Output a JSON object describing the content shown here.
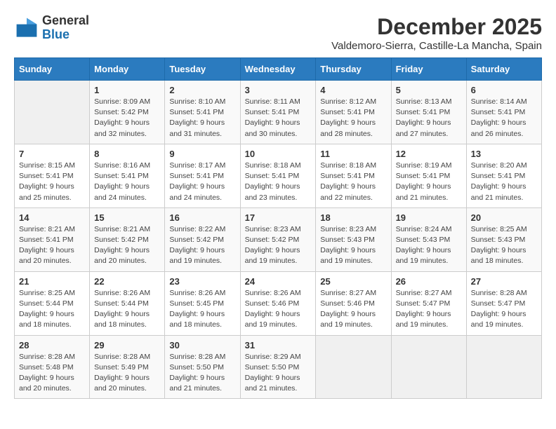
{
  "header": {
    "logo_line1": "General",
    "logo_line2": "Blue",
    "title": "December 2025",
    "subtitle": "Valdemoro-Sierra, Castille-La Mancha, Spain"
  },
  "calendar": {
    "days_of_week": [
      "Sunday",
      "Monday",
      "Tuesday",
      "Wednesday",
      "Thursday",
      "Friday",
      "Saturday"
    ],
    "weeks": [
      [
        {
          "day": "",
          "info": ""
        },
        {
          "day": "1",
          "info": "Sunrise: 8:09 AM\nSunset: 5:42 PM\nDaylight: 9 hours\nand 32 minutes."
        },
        {
          "day": "2",
          "info": "Sunrise: 8:10 AM\nSunset: 5:41 PM\nDaylight: 9 hours\nand 31 minutes."
        },
        {
          "day": "3",
          "info": "Sunrise: 8:11 AM\nSunset: 5:41 PM\nDaylight: 9 hours\nand 30 minutes."
        },
        {
          "day": "4",
          "info": "Sunrise: 8:12 AM\nSunset: 5:41 PM\nDaylight: 9 hours\nand 28 minutes."
        },
        {
          "day": "5",
          "info": "Sunrise: 8:13 AM\nSunset: 5:41 PM\nDaylight: 9 hours\nand 27 minutes."
        },
        {
          "day": "6",
          "info": "Sunrise: 8:14 AM\nSunset: 5:41 PM\nDaylight: 9 hours\nand 26 minutes."
        }
      ],
      [
        {
          "day": "7",
          "info": "Sunrise: 8:15 AM\nSunset: 5:41 PM\nDaylight: 9 hours\nand 25 minutes."
        },
        {
          "day": "8",
          "info": "Sunrise: 8:16 AM\nSunset: 5:41 PM\nDaylight: 9 hours\nand 24 minutes."
        },
        {
          "day": "9",
          "info": "Sunrise: 8:17 AM\nSunset: 5:41 PM\nDaylight: 9 hours\nand 24 minutes."
        },
        {
          "day": "10",
          "info": "Sunrise: 8:18 AM\nSunset: 5:41 PM\nDaylight: 9 hours\nand 23 minutes."
        },
        {
          "day": "11",
          "info": "Sunrise: 8:18 AM\nSunset: 5:41 PM\nDaylight: 9 hours\nand 22 minutes."
        },
        {
          "day": "12",
          "info": "Sunrise: 8:19 AM\nSunset: 5:41 PM\nDaylight: 9 hours\nand 21 minutes."
        },
        {
          "day": "13",
          "info": "Sunrise: 8:20 AM\nSunset: 5:41 PM\nDaylight: 9 hours\nand 21 minutes."
        }
      ],
      [
        {
          "day": "14",
          "info": "Sunrise: 8:21 AM\nSunset: 5:41 PM\nDaylight: 9 hours\nand 20 minutes."
        },
        {
          "day": "15",
          "info": "Sunrise: 8:21 AM\nSunset: 5:42 PM\nDaylight: 9 hours\nand 20 minutes."
        },
        {
          "day": "16",
          "info": "Sunrise: 8:22 AM\nSunset: 5:42 PM\nDaylight: 9 hours\nand 19 minutes."
        },
        {
          "day": "17",
          "info": "Sunrise: 8:23 AM\nSunset: 5:42 PM\nDaylight: 9 hours\nand 19 minutes."
        },
        {
          "day": "18",
          "info": "Sunrise: 8:23 AM\nSunset: 5:43 PM\nDaylight: 9 hours\nand 19 minutes."
        },
        {
          "day": "19",
          "info": "Sunrise: 8:24 AM\nSunset: 5:43 PM\nDaylight: 9 hours\nand 19 minutes."
        },
        {
          "day": "20",
          "info": "Sunrise: 8:25 AM\nSunset: 5:43 PM\nDaylight: 9 hours\nand 18 minutes."
        }
      ],
      [
        {
          "day": "21",
          "info": "Sunrise: 8:25 AM\nSunset: 5:44 PM\nDaylight: 9 hours\nand 18 minutes."
        },
        {
          "day": "22",
          "info": "Sunrise: 8:26 AM\nSunset: 5:44 PM\nDaylight: 9 hours\nand 18 minutes."
        },
        {
          "day": "23",
          "info": "Sunrise: 8:26 AM\nSunset: 5:45 PM\nDaylight: 9 hours\nand 18 minutes."
        },
        {
          "day": "24",
          "info": "Sunrise: 8:26 AM\nSunset: 5:46 PM\nDaylight: 9 hours\nand 19 minutes."
        },
        {
          "day": "25",
          "info": "Sunrise: 8:27 AM\nSunset: 5:46 PM\nDaylight: 9 hours\nand 19 minutes."
        },
        {
          "day": "26",
          "info": "Sunrise: 8:27 AM\nSunset: 5:47 PM\nDaylight: 9 hours\nand 19 minutes."
        },
        {
          "day": "27",
          "info": "Sunrise: 8:28 AM\nSunset: 5:47 PM\nDaylight: 9 hours\nand 19 minutes."
        }
      ],
      [
        {
          "day": "28",
          "info": "Sunrise: 8:28 AM\nSunset: 5:48 PM\nDaylight: 9 hours\nand 20 minutes."
        },
        {
          "day": "29",
          "info": "Sunrise: 8:28 AM\nSunset: 5:49 PM\nDaylight: 9 hours\nand 20 minutes."
        },
        {
          "day": "30",
          "info": "Sunrise: 8:28 AM\nSunset: 5:50 PM\nDaylight: 9 hours\nand 21 minutes."
        },
        {
          "day": "31",
          "info": "Sunrise: 8:29 AM\nSunset: 5:50 PM\nDaylight: 9 hours\nand 21 minutes."
        },
        {
          "day": "",
          "info": ""
        },
        {
          "day": "",
          "info": ""
        },
        {
          "day": "",
          "info": ""
        }
      ]
    ]
  }
}
